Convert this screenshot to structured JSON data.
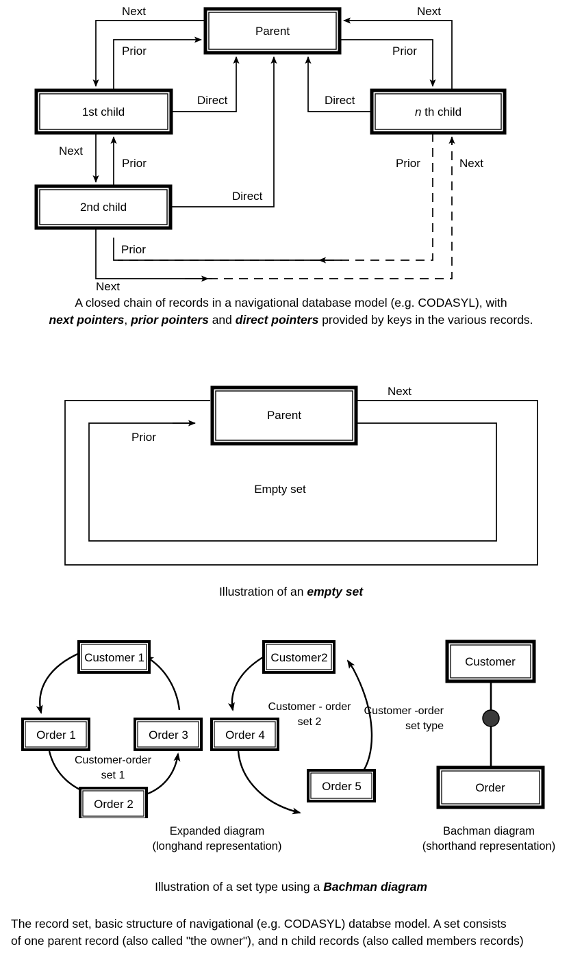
{
  "figure1": {
    "name": "closed-chain-of-records",
    "boxes": [
      {
        "id": "parent",
        "label": "Parent"
      },
      {
        "id": "first-child",
        "label": "1st child"
      },
      {
        "id": "second-child",
        "label": "2nd child"
      },
      {
        "id": "nth-child",
        "label_italic": "n",
        "label_rest": " th child"
      }
    ],
    "edge_labels": {
      "next_top_left": "Next",
      "next_top_right": "Next",
      "prior_top_left": "Prior",
      "prior_top_right": "Prior",
      "direct_left": "Direct",
      "direct_right": "Direct",
      "next_left_vertical": "Next",
      "prior_left_vertical": "Prior",
      "direct_bottom": "Direct",
      "prior_right_vertical": "Prior",
      "next_right_vertical": "Next",
      "prior_bottom": "Prior",
      "next_bottom": "Next"
    },
    "caption_line1": "A closed chain of records in a navigational database model (e.g. CODASYL), with",
    "caption_line2_parts": [
      {
        "text": "next pointers",
        "bold": true
      },
      {
        "text": ", ",
        "bold": false
      },
      {
        "text": "prior pointers",
        "bold": true
      },
      {
        "text": " and ",
        "bold": false
      },
      {
        "text": "direct pointers",
        "bold": true
      },
      {
        "text": " provided by keys in the various records.",
        "bold": false
      }
    ]
  },
  "figure2": {
    "name": "empty-set",
    "boxes": [
      {
        "id": "parent",
        "label": "Parent"
      }
    ],
    "edge_labels": {
      "next": "Next",
      "prior": "Prior"
    },
    "inner_label": "Empty set",
    "caption_parts": [
      {
        "text": "Illustration of an ",
        "bold": false
      },
      {
        "text": "empty set",
        "bold": true
      }
    ]
  },
  "figure3": {
    "name": "set-type-bachman",
    "expanded_set_1": {
      "boxes": [
        {
          "id": "customer-1",
          "label": "Customer 1"
        },
        {
          "id": "order-1",
          "label": "Order 1"
        },
        {
          "id": "order-3",
          "label": "Order 3"
        },
        {
          "id": "order-2",
          "label": "Order 2"
        }
      ],
      "set_label_line1": "Customer-order",
      "set_label_line2": "set 1"
    },
    "expanded_set_2": {
      "boxes": [
        {
          "id": "customer-2",
          "label": "Customer2"
        },
        {
          "id": "order-4",
          "label": "Order 4"
        },
        {
          "id": "order-5",
          "label": "Order 5"
        }
      ],
      "set_label_line1": "Customer - order",
      "set_label_line2": "set 2"
    },
    "bachman": {
      "boxes": [
        {
          "id": "customer",
          "label": "Customer"
        },
        {
          "id": "order",
          "label": "Order"
        }
      ],
      "set_label_line1": "Customer -order",
      "set_label_line2": "set type"
    },
    "subcaption_left_line1": "Expanded diagram",
    "subcaption_left_line2": "(longhand representation)",
    "subcaption_right_line1": "Bachman diagram",
    "subcaption_right_line2": "(shorthand representation)",
    "caption_parts": [
      {
        "text": "Illustration of a set type using a ",
        "bold": false
      },
      {
        "text": "Bachman diagram",
        "bold": true
      }
    ]
  },
  "footer": {
    "line1": "The record set, basic structure of navigational (e.g. CODASYL) databse model. A set consists",
    "line2": "of one parent record (also called \"the owner\"), and n child records (also called members records)"
  },
  "colors": {
    "ink": "#000000",
    "paper": "#ffffff",
    "box_shadow": "#3a3a3a"
  }
}
